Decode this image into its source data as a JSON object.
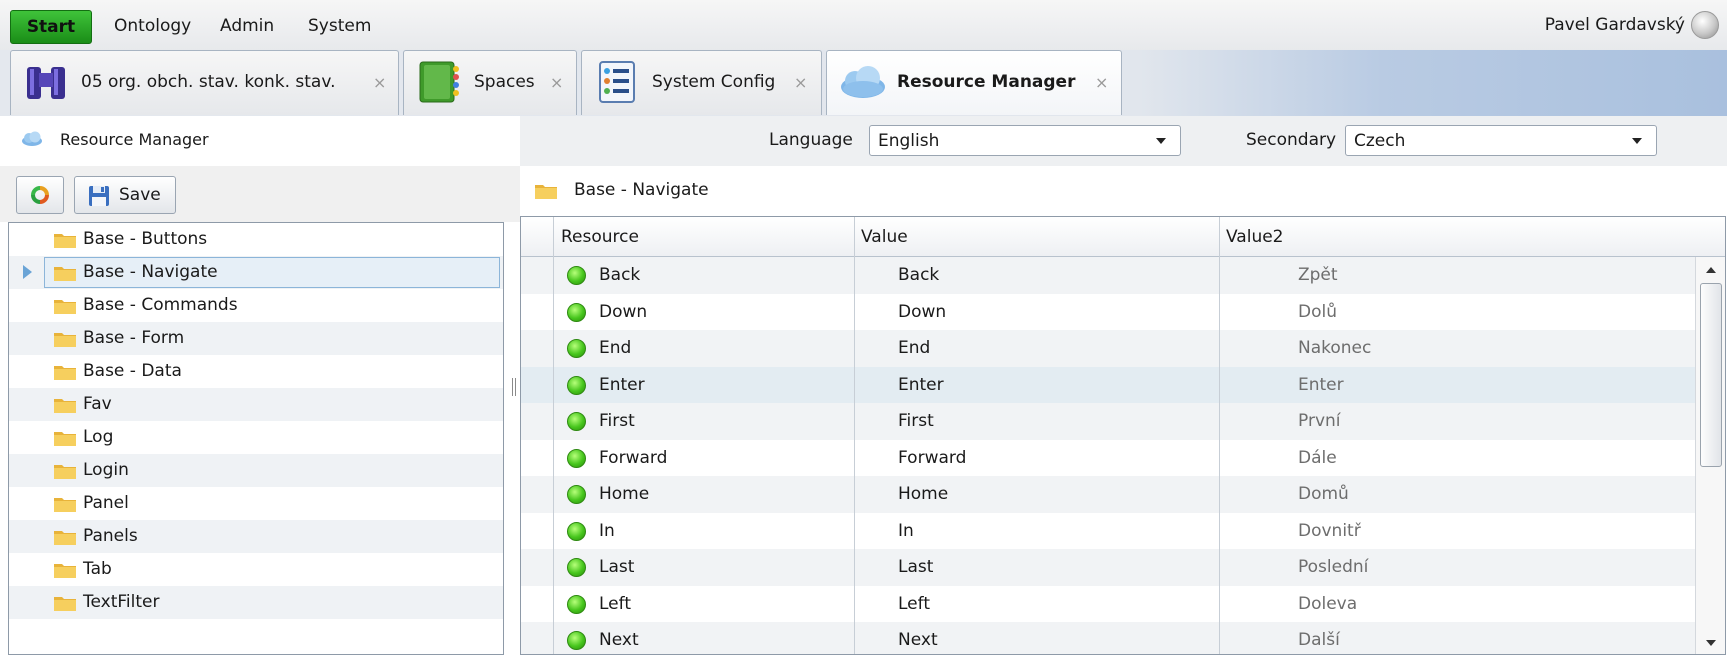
{
  "menubar": {
    "start_label": "Start",
    "items": [
      "Ontology",
      "Admin",
      "System"
    ],
    "user_name": "Pavel Gardavský"
  },
  "tabs": [
    {
      "label": "05 org. obch. stav. konk. stav.",
      "icon": "binoculars-icon",
      "active": false
    },
    {
      "label": "Spaces",
      "icon": "book-icon",
      "active": false
    },
    {
      "label": "System Config",
      "icon": "list-icon",
      "active": false
    },
    {
      "label": "Resource Manager",
      "icon": "cloud-icon",
      "active": true
    }
  ],
  "tab_close_glyph": "×",
  "left_panel": {
    "title": "Resource Manager",
    "save_label": "Save",
    "tree_items": [
      "Base - Buttons",
      "Base - Navigate",
      "Base - Commands",
      "Base - Form",
      "Base - Data",
      "Fav",
      "Log",
      "Login",
      "Panel",
      "Panels",
      "Tab",
      "TextFilter"
    ],
    "selected_item": "Base - Navigate"
  },
  "lang_bar": {
    "language_label": "Language",
    "language_value": "English",
    "secondary_label": "Secondary",
    "secondary_value": "Czech"
  },
  "crumb": {
    "label": "Base - Navigate"
  },
  "grid": {
    "columns": [
      "Resource",
      "Value",
      "Value2"
    ],
    "rows": [
      [
        "Back",
        "Back",
        "Zpět"
      ],
      [
        "Down",
        "Down",
        "Dolů"
      ],
      [
        "End",
        "End",
        "Nakonec"
      ],
      [
        "Enter",
        "Enter",
        "Enter"
      ],
      [
        "First",
        "First",
        "První"
      ],
      [
        "Forward",
        "Forward",
        "Dále"
      ],
      [
        "Home",
        "Home",
        "Domů"
      ],
      [
        "In",
        "In",
        "Dovnitř"
      ],
      [
        "Last",
        "Last",
        "Poslední"
      ],
      [
        "Left",
        "Left",
        "Doleva"
      ],
      [
        "Next",
        "Next",
        "Další"
      ]
    ],
    "highlighted_row": "Enter"
  },
  "colors": {
    "start_green": "#2aa825",
    "status_green": "#47c61d",
    "selection_blue": "#8cb5d9"
  }
}
